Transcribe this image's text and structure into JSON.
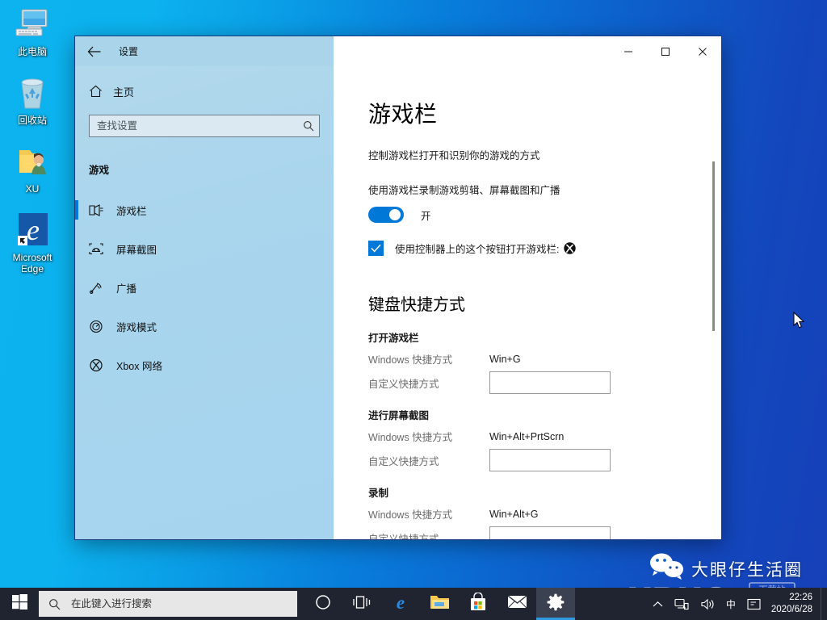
{
  "desktop": {
    "icons": [
      {
        "label": "此电脑",
        "icon": "this-pc-icon"
      },
      {
        "label": "回收站",
        "icon": "recycle-bin-icon"
      },
      {
        "label": "XU",
        "icon": "user-folder-icon"
      },
      {
        "label": "Microsoft Edge",
        "icon": "edge-icon"
      }
    ]
  },
  "window": {
    "title": "设置",
    "back_label": "←",
    "minimize_label": "—",
    "maximize_label": "□",
    "close_label": "✕"
  },
  "sidebar": {
    "home_label": "主页",
    "search": {
      "placeholder": "查找设置",
      "value": ""
    },
    "group_title": "游戏",
    "items": [
      {
        "label": "游戏栏",
        "icon": "game-bar-icon",
        "selected": true
      },
      {
        "label": "屏幕截图",
        "icon": "screenshot-icon",
        "selected": false
      },
      {
        "label": "广播",
        "icon": "broadcast-icon",
        "selected": false
      },
      {
        "label": "游戏模式",
        "icon": "game-mode-icon",
        "selected": false
      },
      {
        "label": "Xbox 网络",
        "icon": "xbox-network-icon",
        "selected": false
      }
    ]
  },
  "main": {
    "page_title": "游戏栏",
    "page_description": "控制游戏栏打开和识别你的游戏的方式",
    "record_setting_label": "使用游戏栏录制游戏剪辑、屏幕截图和广播",
    "toggle_state_label": "开",
    "toggle_on": true,
    "controller_checkbox_label": "使用控制器上的这个按钮打开游戏栏:",
    "controller_checkbox_checked": true,
    "controller_glyph": "xbox-logo-icon",
    "shortcuts_section_title": "键盘快捷方式",
    "shortcuts": [
      {
        "name": "打开游戏栏",
        "windows_label": "Windows 快捷方式",
        "windows_value": "Win+G",
        "custom_label": "自定义快捷方式",
        "custom_value": ""
      },
      {
        "name": "进行屏幕截图",
        "windows_label": "Windows 快捷方式",
        "windows_value": "Win+Alt+PrtScrn",
        "custom_label": "自定义快捷方式",
        "custom_value": ""
      },
      {
        "name": "录制",
        "windows_label": "Windows 快捷方式",
        "windows_value": "Win+Alt+G",
        "custom_label": "自定义快捷方式",
        "custom_value": ""
      }
    ]
  },
  "taskbar": {
    "start_icon": "windows-logo-icon",
    "search": {
      "placeholder": "在此键入进行搜索",
      "value": ""
    },
    "items": [
      {
        "name": "cortana-icon",
        "label": ""
      },
      {
        "name": "task-view-icon",
        "label": ""
      },
      {
        "name": "edge-icon",
        "label": ""
      },
      {
        "name": "file-explorer-icon",
        "label": ""
      },
      {
        "name": "microsoft-store-icon",
        "label": ""
      },
      {
        "name": "mail-icon",
        "label": ""
      },
      {
        "name": "settings-icon",
        "label": ""
      }
    ],
    "tray": {
      "chevron": "⌃",
      "network_icon": "network-icon",
      "volume_icon": "volume-icon",
      "ime_label": "中",
      "action_center_icon": "action-center-icon",
      "time": "22:26",
      "date": "2020/6/28"
    }
  },
  "watermarks": {
    "wechat_text": "大眼仔生活圈",
    "site_text": "UBUG",
    "site_suffix": ".com",
    "site_badge": "下载站"
  },
  "colors": {
    "accent": "#0078d7",
    "sidebar_bg": "#a9d5ed",
    "taskbar_bg": "#1f2430",
    "desktop_start": "#0cb3ef",
    "desktop_end": "#1640b8"
  }
}
